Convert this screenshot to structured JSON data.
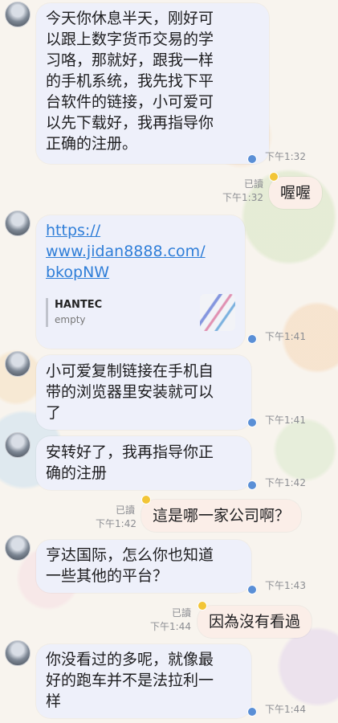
{
  "messages": [
    {
      "text": "今天你休息半天，刚好可以跟上数字货币交易的学习咯，那就好，跟我一样的手机系统，我先找下平台软件的链接，小可爱可以先下载好，我再指导你正确的注册。",
      "lines": [
        "今天你休息半天，刚好可",
        "以跟上数字货币交易的学",
        "习咯，那就好，跟我一样",
        "的手机系统，我先找下平",
        "台软件的链接，小可爱可",
        "以先下载好，我再指导你",
        "正确的注册。"
      ],
      "time": "下午1:32"
    },
    {
      "text": "喔喔",
      "time": "下午1:32",
      "read": "已讀"
    },
    {
      "link_lines": [
        "https://",
        "www.jidan8888.com/",
        "bkopNW"
      ],
      "preview_title": "HANTEC",
      "preview_desc": "empty",
      "time": "下午1:41"
    },
    {
      "lines": [
        "小可爱复制链接在手机自",
        "带的浏览器里安装就可以",
        "了"
      ],
      "time": "下午1:41"
    },
    {
      "lines": [
        "安转好了，我再指导你正",
        "确的注册"
      ],
      "time": "下午1:42"
    },
    {
      "text": "這是哪一家公司啊？",
      "time": "下午1:42",
      "read": "已讀"
    },
    {
      "lines": [
        "亨达国际，怎么你也知道",
        "一些其他的平台？"
      ],
      "time": "下午1:43"
    },
    {
      "text": "因為沒有看過",
      "time": "下午1:44",
      "read": "已讀"
    },
    {
      "lines": [
        "你没看过的多呢，就像最",
        "好的跑车并不是法拉利一",
        "样"
      ],
      "time": "下午1:44"
    }
  ],
  "colors": {
    "incoming_bubble": "#eef0fa",
    "outgoing_bubble": "#fbeee8",
    "link": "#2f7ed8"
  }
}
